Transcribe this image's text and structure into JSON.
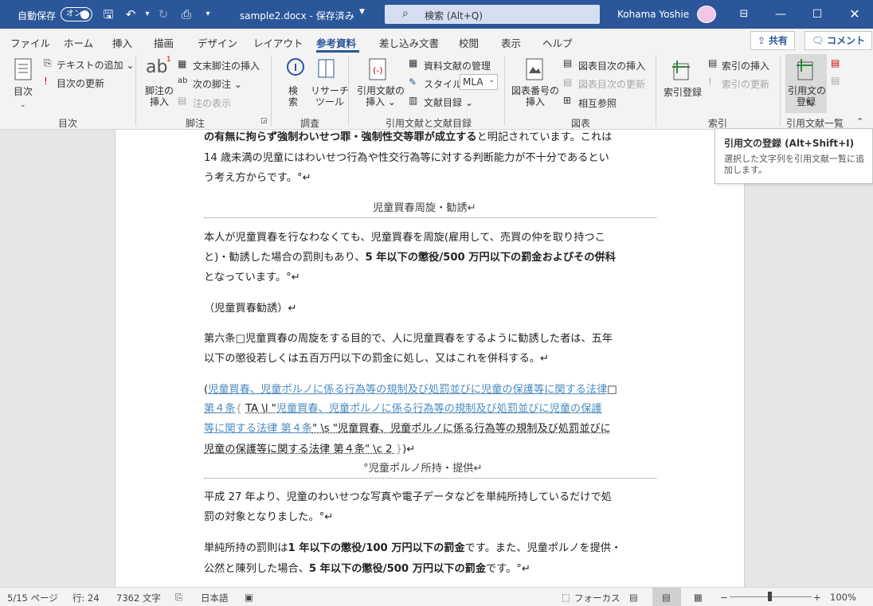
{
  "titlebar": {
    "autosave_label": "自動保存",
    "autosave_state": "オン",
    "doc_title": "sample2.docx - 保存済み",
    "search_placeholder": "検索 (Alt+Q)",
    "user_name": "Kohama Yoshie"
  },
  "tabs": [
    "ファイル",
    "ホーム",
    "挿入",
    "描画",
    "デザイン",
    "レイアウト",
    "参考資料",
    "差し込み文書",
    "校閲",
    "表示",
    "ヘルプ"
  ],
  "active_tab": "参考資料",
  "share_label": "共有",
  "comment_label": "コメント",
  "ribbon": {
    "toc": {
      "btn": "目次",
      "add_text": "テキストの追加",
      "update": "目次の更新",
      "group": "目次"
    },
    "footnotes": {
      "insert1": "脚注の",
      "insert2": "挿入",
      "endnote": "文末脚注の挿入",
      "next": "次の脚注",
      "show": "注の表示",
      "group": "脚注",
      "icon_text": "ab"
    },
    "research": {
      "search1": "検",
      "search2": "索",
      "researcher1": "リサーチ",
      "researcher2": "ツール",
      "group": "調査"
    },
    "citations": {
      "insert1": "引用文献の",
      "insert2": "挿入",
      "manage": "資料文献の管理",
      "style_label": "スタイル:",
      "style_value": "MLA",
      "bibliography": "文献目録",
      "group": "引用文献と文献目録"
    },
    "captions": {
      "insert1": "図表番号の",
      "insert2": "挿入",
      "tof": "図表目次の挿入",
      "update_tof": "図表目次の更新",
      "crossref": "相互参照",
      "group": "図表"
    },
    "index": {
      "mark": "索引登録",
      "insert": "索引の挿入",
      "update": "索引の更新",
      "group": "索引"
    },
    "toa": {
      "mark1": "引用文の",
      "mark2": "登録",
      "group": "引用文献一覧"
    }
  },
  "tooltip": {
    "title": "引用文の登録 (Alt+Shift+I)",
    "desc": "選択した文字列を引用文献一覧に追加します。"
  },
  "document": {
    "l1a": "の有無に拘らず強制わいせつ罪・強制性交等罪が成立する",
    "l1b": "と明記されています。これは",
    "l2": "14 歳未満の児童にはわいせつ行為や性交行為等に対する判断能力が不十分であるとい",
    "l3": "う考え方からです。°↵",
    "h1": "児童買春周旋・勧誘↵",
    "p2_l1": "本人が児童買春を行なわなくても、児童買春を周旋(雇用して、売買の仲を取り持つこ",
    "p2_l2a": "と)・勧誘した場合の罰則もあり、",
    "p2_l2b": "5 年以下の懲役/500 万円以下の罰金およびその併科",
    "p2_l3": "となっています。°↵",
    "p3": "（児童買春勧誘）↵",
    "p4_l1": "第六条□児童買春の周旋をする目的で、人に児童買春をするように勧誘した者は、五年",
    "p4_l2": "以下の懲役若しくは五百万円以下の罰金に処し、又はこれを併科する。↵",
    "c_l1_open": "(",
    "c_l1": "児童買春、児童ポルノに係る行為等の規制及び処罰並びに児童の保護等に関する法律",
    "c_l1_end": "□",
    "c_l2a": "第４条",
    "c_l2b": "TA \\l \"",
    "c_l2c": "児童買春、児童ポルノに係る行為等の規制及び処罰並びに児童の保護",
    "c_l3a": "等に関する法律 第４条",
    "c_l3b": "\" \\s \"児童買春、児童ポルノに係る行為等の規制及び処罰並びに",
    "c_l4": "児童の保護等に関する法律 第４条\" \\c 2 ",
    "c_l4_end": ")↵",
    "h2": "°児童ポルノ所持・提供↵",
    "p5_l1": "平成 27 年より、児童のわいせつな写真や電子データなどを単純所持しているだけで処",
    "p5_l2": "罰の対象となりました。°↵",
    "p6_l1a": "単純所持の罰則は",
    "p6_l1b": "1 年以下の懲役/100 万円以下の罰金",
    "p6_l1c": "です。また、児童ポルノを提供・",
    "p6_l2a": "公然と陳列した場合、",
    "p6_l2b": "5 年以下の懲役/500 万円以下の罰金",
    "p6_l2c": "です。°↵"
  },
  "status": {
    "page": "5/15 ページ",
    "line": "行: 24",
    "words": "7362 文字",
    "lang": "日本語",
    "focus": "フォーカス",
    "zoom": "100%",
    "zoom_level": 1.0
  },
  "colors": {
    "accent": "#2b579a",
    "citation_link": "#4b8bbe"
  }
}
